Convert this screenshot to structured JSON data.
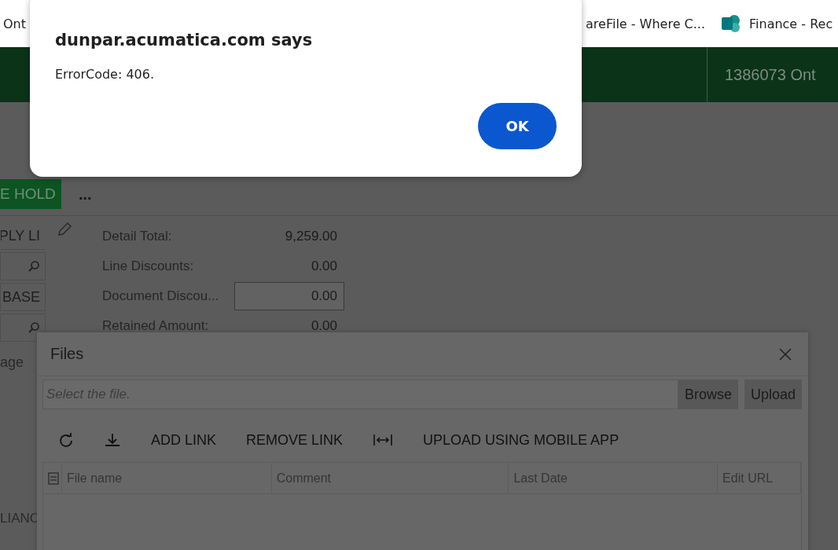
{
  "bookmarks": [
    {
      "label": "Ont"
    },
    {
      "label": "areFile - Where C..."
    },
    {
      "label": "Finance - Rec"
    }
  ],
  "header": {
    "company": "1386073 Ont"
  },
  "actions": {
    "primary": "E HOLD",
    "more": "..."
  },
  "left_fields": [
    {
      "kind": "text",
      "value": "PLY LI"
    },
    {
      "kind": "lookup"
    },
    {
      "kind": "text",
      "value": "BASE"
    },
    {
      "kind": "lookup"
    },
    {
      "kind": "label",
      "value": "age"
    }
  ],
  "totals": [
    {
      "label": "Detail Total:",
      "value": "9,259.00",
      "editable": false
    },
    {
      "label": "Line Discounts:",
      "value": "0.00",
      "editable": false
    },
    {
      "label": "Document Discou...",
      "value": "0.00",
      "editable": true
    },
    {
      "label": "Retained Amount:",
      "value": "0.00",
      "editable": false
    }
  ],
  "left_bottom": "LIANC",
  "files_dialog": {
    "title": "Files",
    "file_field": {
      "placeholder": "Select the file."
    },
    "buttons": [
      "Browse",
      "Upload"
    ],
    "toolbar": [
      {
        "kind": "refresh"
      },
      {
        "kind": "download"
      },
      {
        "kind": "text",
        "label": "ADD LINK"
      },
      {
        "kind": "text",
        "label": "REMOVE LINK"
      },
      {
        "kind": "fit"
      },
      {
        "kind": "text",
        "label": "UPLOAD USING MOBILE APP"
      }
    ],
    "columns": [
      "File name",
      "Comment",
      "Last Date",
      "Edit URL"
    ]
  },
  "alert": {
    "title": "dunpar.acumatica.com says",
    "message": "ErrorCode: 406.",
    "button": "OK"
  }
}
